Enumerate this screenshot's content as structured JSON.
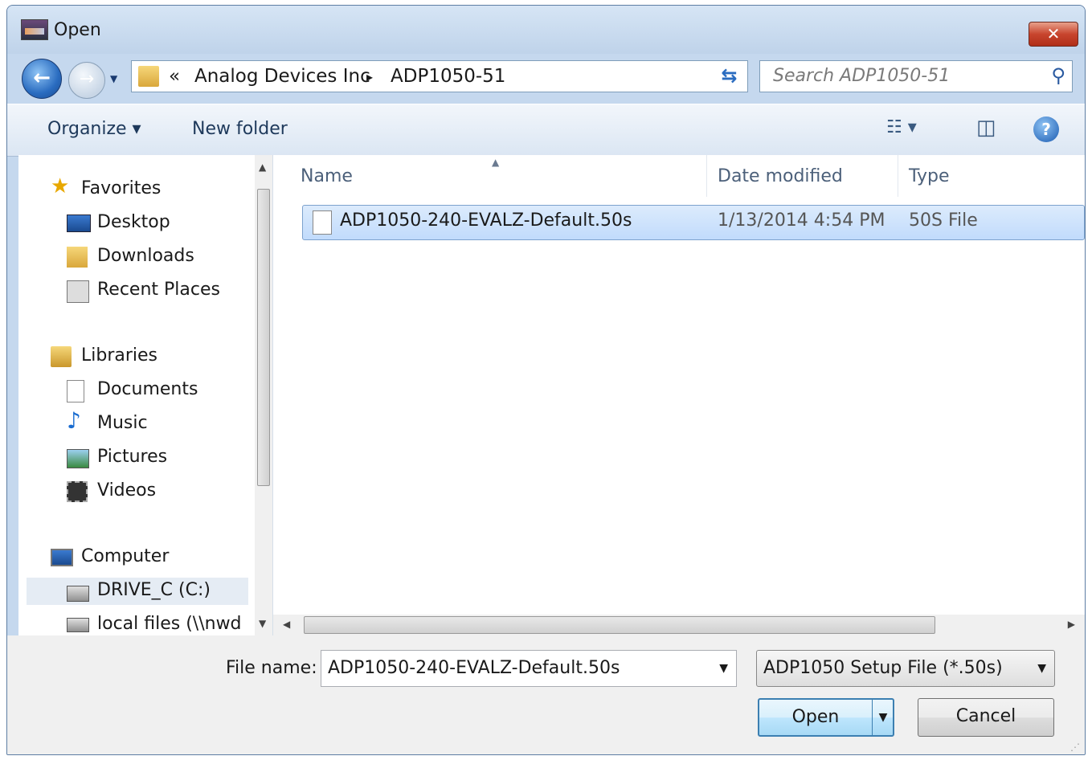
{
  "window": {
    "title": "Open"
  },
  "nav": {
    "breadcrumb": [
      "«",
      "Analog Devices Inc",
      "▸",
      "ADP1050-51"
    ],
    "search_placeholder": "Search ADP1050-51"
  },
  "toolbar": {
    "organize": "Organize ▾",
    "new_folder": "New folder"
  },
  "sidebar": {
    "favorites": "Favorites",
    "fav_items": [
      "Desktop",
      "Downloads",
      "Recent Places"
    ],
    "libraries": "Libraries",
    "lib_items": [
      "Documents",
      "Music",
      "Pictures",
      "Videos"
    ],
    "computer": "Computer",
    "comp_items": [
      "DRIVE_C (C:)",
      "local files (\\\\nwd"
    ]
  },
  "columns": {
    "name": "Name",
    "date": "Date modified",
    "type": "Type"
  },
  "files": [
    {
      "name": "ADP1050-240-EVALZ-Default.50s",
      "date": "1/13/2014 4:54 PM",
      "type": "50S File"
    }
  ],
  "footer": {
    "file_name_label": "File name:",
    "file_name_value": "ADP1050-240-EVALZ-Default.50s",
    "filter_value": "ADP1050 Setup File  (*.50s)",
    "open_label": "Open",
    "cancel_label": "Cancel"
  },
  "icons": {
    "back": "back-arrow-icon",
    "forward": "forward-arrow-icon",
    "refresh": "refresh-icon",
    "search": "search-icon",
    "views": "views-icon",
    "preview": "preview-pane-icon",
    "help": "help-icon"
  },
  "colors": {
    "selection": "#c1dbfc",
    "title_bar": "#bfd3ea",
    "close": "#c8452e"
  }
}
